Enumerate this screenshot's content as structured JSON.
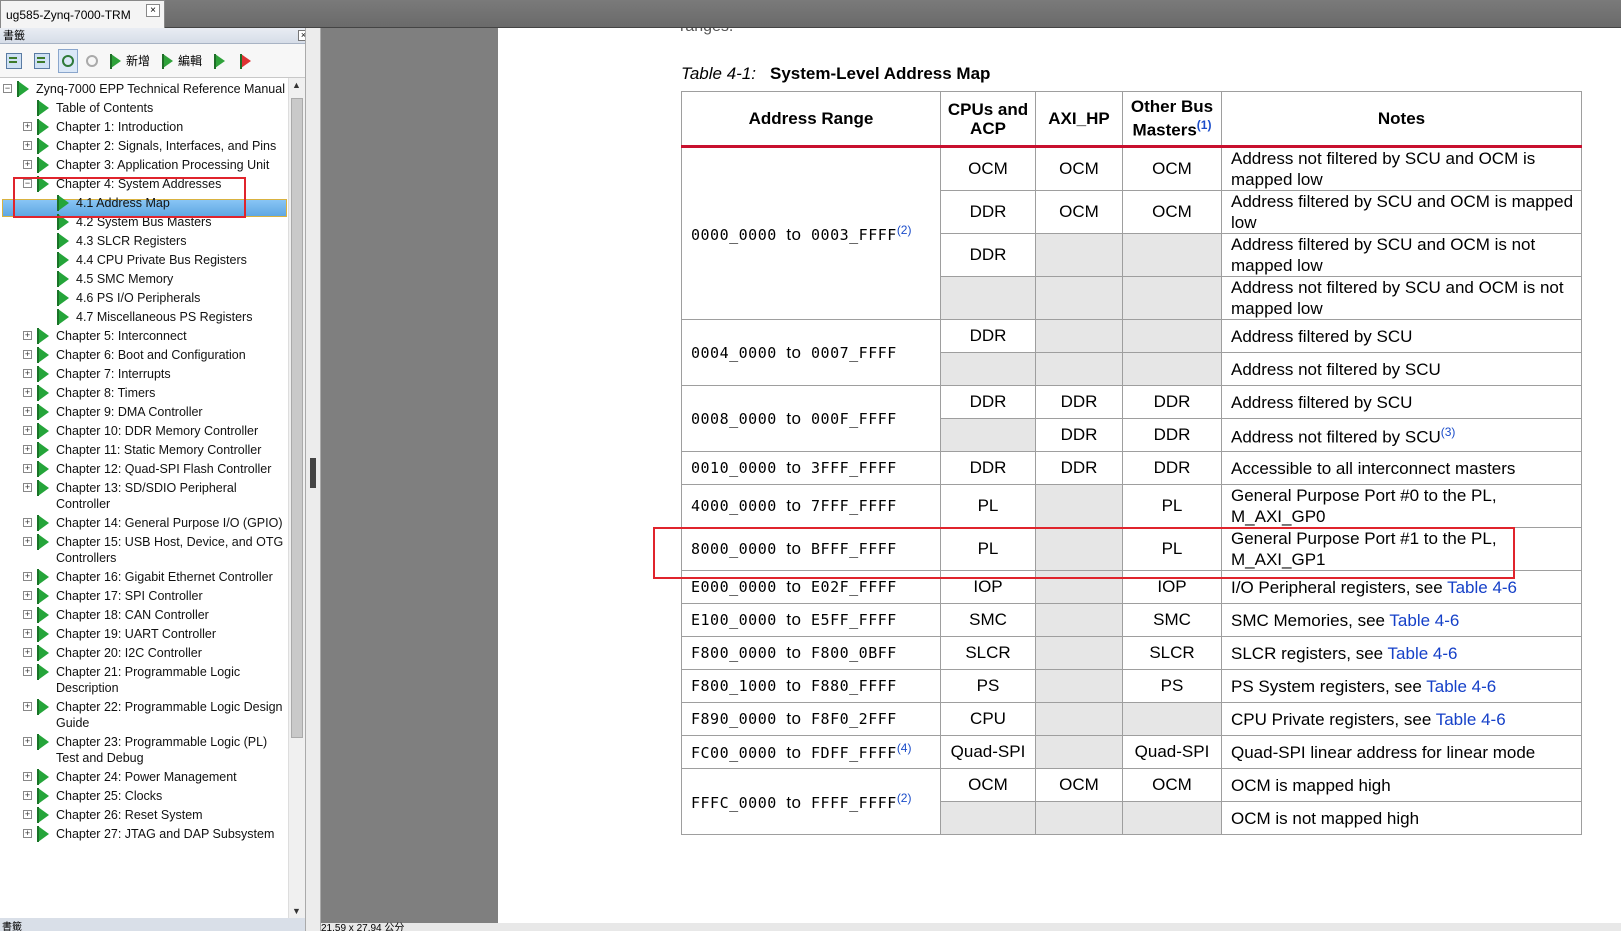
{
  "tab": {
    "title": "ug585-Zynq-7000-TRM",
    "close": "×"
  },
  "panel": {
    "title": "書籤",
    "close": "×",
    "bottom_label": "書籤"
  },
  "toolbar": {
    "add_label": "新增",
    "edit_label": "編輯"
  },
  "tree": {
    "root": "Zynq-7000 EPP Technical Reference Manual",
    "items": [
      {
        "label": "Table of Contents",
        "expander": "",
        "level": 1
      },
      {
        "label": "Chapter 1: Introduction",
        "expander": "+",
        "level": 1
      },
      {
        "label": "Chapter 2: Signals, Interfaces, and Pins",
        "expander": "+",
        "level": 1
      },
      {
        "label": "Chapter 3: Application Processing Unit",
        "expander": "+",
        "level": 1
      },
      {
        "label": "Chapter 4: System Addresses",
        "expander": "−",
        "level": 1
      },
      {
        "label": "4.1 Address Map",
        "expander": "",
        "level": 2,
        "selected": true
      },
      {
        "label": "4.2 System Bus Masters",
        "expander": "",
        "level": 2
      },
      {
        "label": "4.3 SLCR Registers",
        "expander": "",
        "level": 2
      },
      {
        "label": "4.4 CPU Private Bus Registers",
        "expander": "",
        "level": 2
      },
      {
        "label": "4.5 SMC Memory",
        "expander": "",
        "level": 2
      },
      {
        "label": "4.6 PS I/O Peripherals",
        "expander": "",
        "level": 2
      },
      {
        "label": "4.7 Miscellaneous PS Registers",
        "expander": "",
        "level": 2
      },
      {
        "label": "Chapter 5: Interconnect",
        "expander": "+",
        "level": 1
      },
      {
        "label": "Chapter 6: Boot and Configuration",
        "expander": "+",
        "level": 1
      },
      {
        "label": "Chapter 7: Interrupts",
        "expander": "+",
        "level": 1
      },
      {
        "label": "Chapter 8: Timers",
        "expander": "+",
        "level": 1
      },
      {
        "label": "Chapter 9: DMA Controller",
        "expander": "+",
        "level": 1
      },
      {
        "label": "Chapter 10: DDR Memory Controller",
        "expander": "+",
        "level": 1
      },
      {
        "label": "Chapter 11: Static Memory Controller",
        "expander": "+",
        "level": 1
      },
      {
        "label": "Chapter 12: Quad-SPI Flash Controller",
        "expander": "+",
        "level": 1
      },
      {
        "label": "Chapter 13: SD/SDIO Peripheral Controller",
        "expander": "+",
        "level": 1
      },
      {
        "label": "Chapter 14: General Purpose I/O (GPIO)",
        "expander": "+",
        "level": 1
      },
      {
        "label": "Chapter 15: USB Host, Device, and OTG Controllers",
        "expander": "+",
        "level": 1
      },
      {
        "label": "Chapter 16: Gigabit Ethernet Controller",
        "expander": "+",
        "level": 1
      },
      {
        "label": "Chapter 17: SPI Controller",
        "expander": "+",
        "level": 1
      },
      {
        "label": "Chapter 18: CAN Controller",
        "expander": "+",
        "level": 1
      },
      {
        "label": "Chapter 19: UART Controller",
        "expander": "+",
        "level": 1
      },
      {
        "label": "Chapter 20: I2C Controller",
        "expander": "+",
        "level": 1
      },
      {
        "label": "Chapter 21: Programmable Logic Description",
        "expander": "+",
        "level": 1
      },
      {
        "label": "Chapter 22: Programmable Logic Design Guide",
        "expander": "+",
        "level": 1
      },
      {
        "label": "Chapter 23: Programmable Logic (PL) Test and Debug",
        "expander": "+",
        "level": 1
      },
      {
        "label": "Chapter 24: Power Management",
        "expander": "+",
        "level": 1
      },
      {
        "label": "Chapter 25: Clocks",
        "expander": "+",
        "level": 1
      },
      {
        "label": "Chapter 26: Reset System",
        "expander": "+",
        "level": 1
      },
      {
        "label": "Chapter 27: JTAG and DAP Subsystem",
        "expander": "+",
        "level": 1
      }
    ]
  },
  "document": {
    "cut_text": "ranges.",
    "caption_label": "Table 4-1:",
    "caption_title": "System-Level Address Map",
    "headers": {
      "range": "Address Range",
      "cpu": "CPUs and ACP",
      "axi": "AXI_HP",
      "other": "Other Bus Masters",
      "other_fn": "(1)",
      "notes": "Notes"
    },
    "to": "to",
    "xref": "Table 4-6",
    "rows": {
      "r1_from": "0000_0000",
      "r1_to": "0003_FFFF",
      "r1_fn": "(2)",
      "r2_from": "0004_0000",
      "r2_to": "0007_FFFF",
      "r3_from": "0008_0000",
      "r3_to": "000F_FFFF",
      "r4_from": "0010_0000",
      "r4_to": "3FFF_FFFF",
      "r5_from": "4000_0000",
      "r5_to": "7FFF_FFFF",
      "r6_from": "8000_0000",
      "r6_to": "BFFF_FFFF",
      "r7_from": "E000_0000",
      "r7_to": "E02F_FFFF",
      "r8_from": "E100_0000",
      "r8_to": "E5FF_FFFF",
      "r9_from": "F800_0000",
      "r9_to": "F800_0BFF",
      "r10_from": "F800_1000",
      "r10_to": "F880_FFFF",
      "r11_from": "F890_0000",
      "r11_to": "F8F0_2FFF",
      "r12_from": "FC00_0000",
      "r12_to": "FDFF_FFFF",
      "r12_fn": "(4)",
      "r13_from": "FFFC_0000",
      "r13_to": "FFFF_FFFF",
      "r13_fn": "(2)"
    },
    "cells": {
      "ocm": "OCM",
      "ddr": "DDR",
      "pl": "PL",
      "iop": "IOP",
      "smc": "SMC",
      "slcr": "SLCR",
      "ps": "PS",
      "cpu": "CPU",
      "qspi": "Quad-SPI"
    },
    "notes": {
      "n1": "Address not filtered by SCU and OCM is mapped low",
      "n2": "Address filtered by SCU and OCM is mapped low",
      "n3": "Address filtered by SCU and OCM is not mapped low",
      "n4": "Address not filtered by SCU and OCM is not mapped low",
      "n5": "Address filtered by SCU",
      "n6": "Address not filtered by SCU",
      "n7": "Address filtered by SCU",
      "n8": "Address not filtered by SCU",
      "n8_fn": "(3)",
      "n9": "Accessible to all interconnect masters",
      "n10": "General Purpose Port #0 to the PL, M_AXI_GP0",
      "n11": "General Purpose Port #1 to the PL, M_AXI_GP1",
      "n12": "I/O Peripheral registers, see",
      "n13": "SMC Memories, see",
      "n14": "SLCR registers, see",
      "n15": "PS System registers, see",
      "n16": "CPU Private registers, see",
      "n17": "Quad-SPI linear address for linear mode",
      "n18": "OCM is mapped high",
      "n19": "OCM is not mapped high"
    }
  },
  "status": {
    "text": "21.59 x 27.94 公分"
  }
}
